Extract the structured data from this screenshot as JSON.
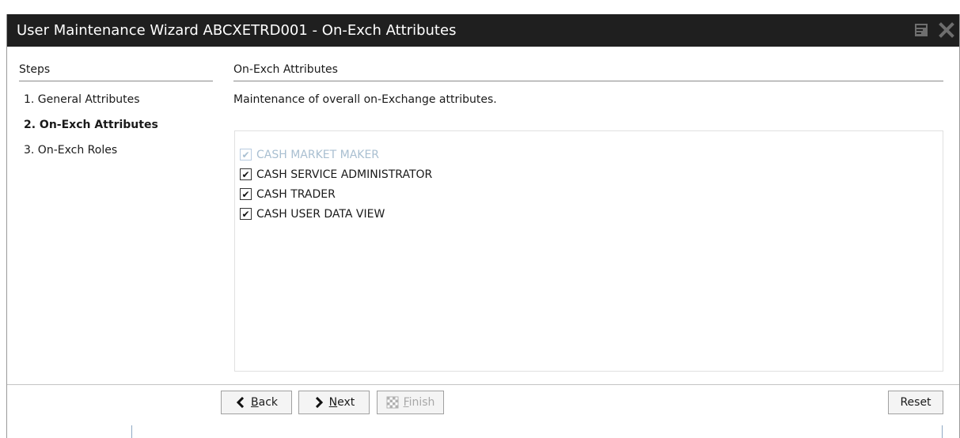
{
  "window": {
    "title": "User Maintenance Wizard ABCXETRD001 - On-Exch Attributes"
  },
  "steps": {
    "heading": "Steps",
    "items": [
      {
        "label": "1. General Attributes",
        "active": false
      },
      {
        "label": "2. On-Exch Attributes",
        "active": true
      },
      {
        "label": "3. On-Exch Roles",
        "active": false
      }
    ]
  },
  "content": {
    "heading": "On-Exch Attributes",
    "description": "Maintenance of overall on-Exchange attributes.",
    "attributes": [
      {
        "label": "CASH MARKET MAKER",
        "checked": true,
        "enabled": false
      },
      {
        "label": "CASH SERVICE ADMINISTRATOR",
        "checked": true,
        "enabled": true
      },
      {
        "label": "CASH TRADER",
        "checked": true,
        "enabled": true
      },
      {
        "label": "CASH USER DATA VIEW",
        "checked": true,
        "enabled": true
      }
    ]
  },
  "buttons": {
    "back": {
      "label": "Back",
      "mnemonic": "B",
      "rest": "ack"
    },
    "next": {
      "label": "Next",
      "mnemonic": "N",
      "rest": "ext"
    },
    "finish": {
      "label": "Finish",
      "mnemonic": "F",
      "rest": "inish",
      "enabled": false
    },
    "reset": {
      "label": "Reset"
    }
  },
  "icons": {
    "minimize": "minimize-window-icon",
    "close": "close-icon",
    "back": "chevron-left-icon",
    "next": "chevron-right-icon",
    "finish": "checkered-flag-icon"
  },
  "colors": {
    "titlebar": "#1f1f1f",
    "disabled_text": "#a9bfd1"
  }
}
